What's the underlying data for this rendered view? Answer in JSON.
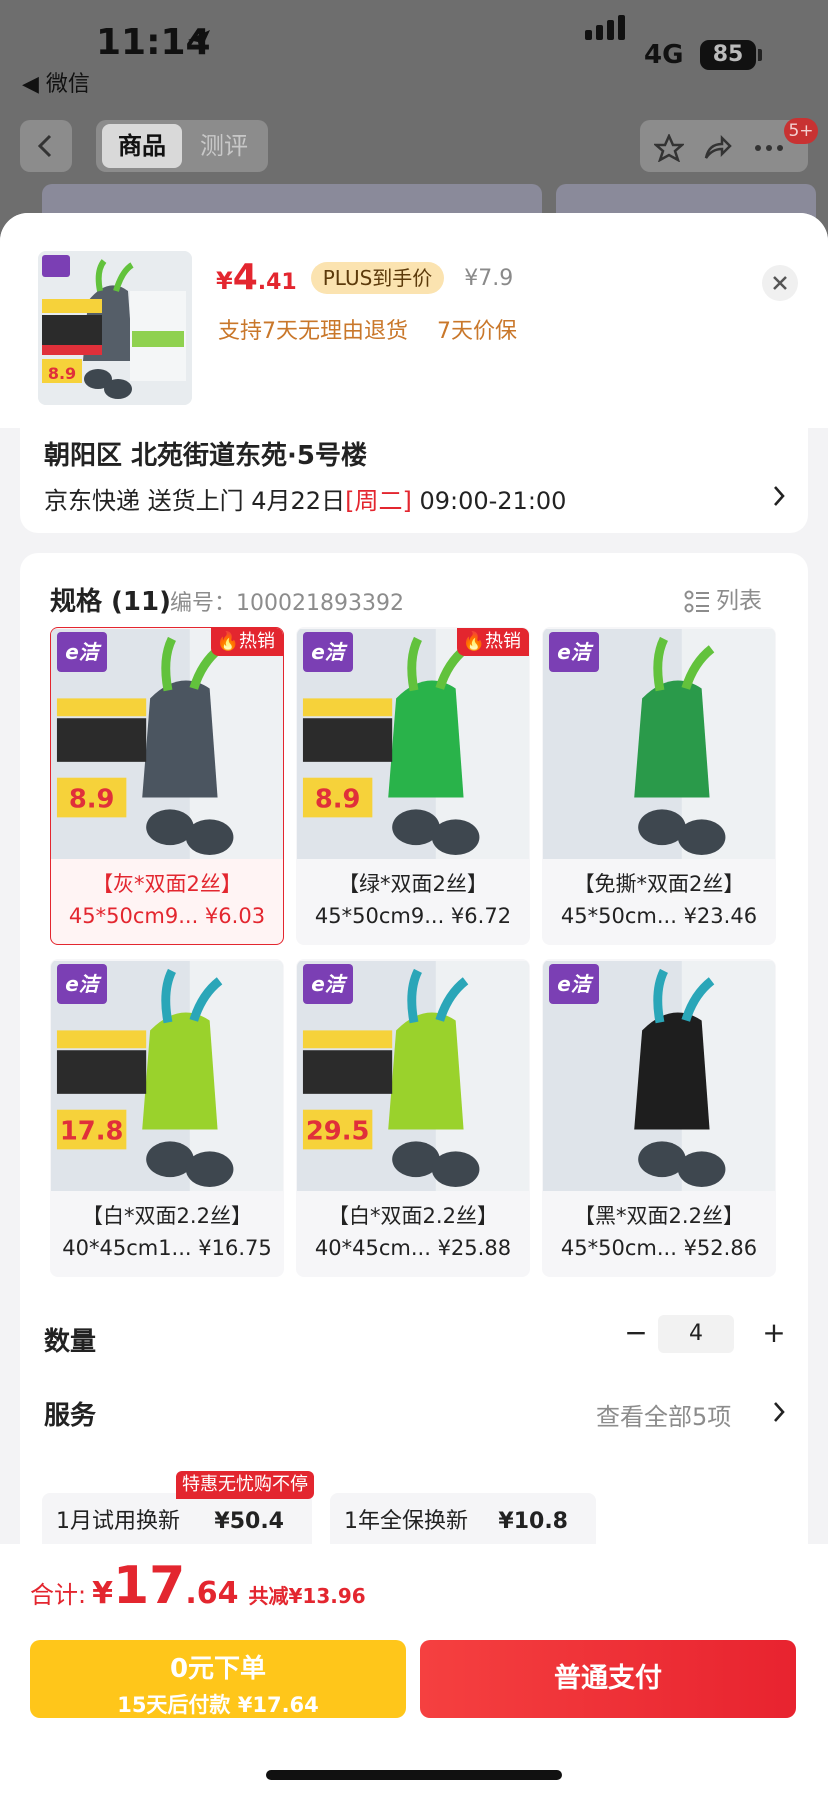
{
  "status_bar": {
    "time": "11:14",
    "back_app": "◀ 微信",
    "network": "4G",
    "battery": "85"
  },
  "nav": {
    "tabs": [
      "商品",
      "测评"
    ],
    "badge": "5+"
  },
  "header": {
    "price_symbol": "¥",
    "price_int": "4",
    "price_dec": ".41",
    "plus_tag": "PLUS到手价",
    "original_price": "¥7.9",
    "guarantees": [
      "支持7天无理由退货",
      "7天价保"
    ]
  },
  "delivery": {
    "address": "朝阳区 北苑街道东苑·5号楼",
    "carrier": "京东快递 送货上门 4月22日",
    "weekday": "[周二]",
    "time_window": "09:00-21:00"
  },
  "spec": {
    "title": "规格 (11)",
    "code": "编号：100021893392",
    "list_toggle": "列表",
    "hot_label": "热销",
    "brand_label": "e洁",
    "items": [
      {
        "name": "【灰*双面2丝】",
        "meta": "45*50cm9... ¥6.03",
        "hot": true,
        "selected": true,
        "color": "#4b5560",
        "promo": "8.9"
      },
      {
        "name": "【绿*双面2丝】",
        "meta": "45*50cm9... ¥6.72",
        "hot": true,
        "selected": false,
        "color": "#29b34a",
        "promo": "8.9"
      },
      {
        "name": "【免撕*双面2丝】",
        "meta": "45*50cm... ¥23.46",
        "hot": false,
        "selected": false,
        "color": "#2a9a4a",
        "promo": ""
      },
      {
        "name": "【白*双面2.2丝】",
        "meta": "40*45cm1... ¥16.75",
        "hot": false,
        "selected": false,
        "color": "#9ad22c",
        "promo": "17.8"
      },
      {
        "name": "【白*双面2.2丝】",
        "meta": "40*45cm... ¥25.88",
        "hot": false,
        "selected": false,
        "color": "#9ad22c",
        "promo": "29.5"
      },
      {
        "name": "【黑*双面2.2丝】",
        "meta": "45*50cm... ¥52.86",
        "hot": false,
        "selected": false,
        "color": "#1e1e1e",
        "promo": ""
      }
    ]
  },
  "quantity": {
    "label": "数量",
    "value": "4",
    "minus": "−",
    "plus": "+"
  },
  "service": {
    "label": "服务",
    "more": "查看全部5项",
    "badge": "特惠无忧购不停",
    "items": [
      {
        "name": "1月试用换新",
        "price": "¥50.4"
      },
      {
        "name": "1年全保换新",
        "price": "¥10.8"
      }
    ]
  },
  "footer": {
    "total_label": "合计:",
    "total_symbol": "¥",
    "total_int": "17",
    "total_dec": ".64",
    "discount": "共减¥13.96",
    "later_title": "0元下单",
    "later_sub": "15天后付款 ¥17.64",
    "pay": "普通支付"
  },
  "colors": {
    "accent": "#e3262f",
    "plus_tag": "#fbe3b0",
    "later_button": "#ffc61a",
    "guarantee": "#c9772a"
  }
}
